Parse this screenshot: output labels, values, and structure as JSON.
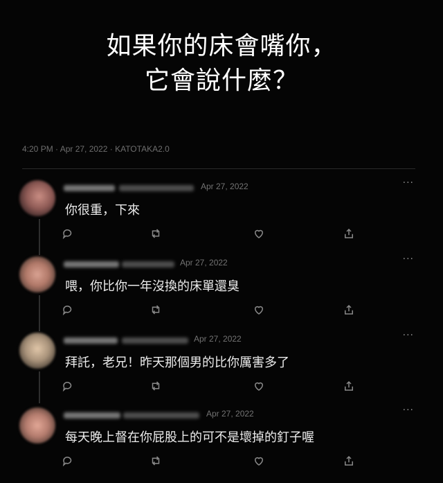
{
  "title": {
    "line1": "如果你的床會嘴你，",
    "line2": "它會說什麼？"
  },
  "tweet_meta": "4:20 PM · Apr 27, 2022 · KATOTAKA2.0",
  "replies": [
    {
      "date": "Apr 27, 2022",
      "text": "你很重，下來",
      "more_label": "···",
      "icons": [
        "reply-icon",
        "retweet-icon",
        "like-icon",
        "share-icon"
      ]
    },
    {
      "date": "Apr 27, 2022",
      "text": "喂，你比你一年沒換的床單還臭",
      "more_label": "···",
      "icons": [
        "reply-icon",
        "retweet-icon",
        "like-icon",
        "share-icon"
      ]
    },
    {
      "date": "Apr 27, 2022",
      "text": "拜託，老兄！昨天那個男的比你厲害多了",
      "more_label": "···",
      "icons": [
        "reply-icon",
        "retweet-icon",
        "like-icon",
        "share-icon"
      ]
    },
    {
      "date": "Apr 27, 2022",
      "text": "每天晚上督在你屁股上的可不是壞掉的釘子喔",
      "more_label": "···",
      "icons": [
        "reply-icon",
        "retweet-icon",
        "like-icon",
        "share-icon"
      ]
    }
  ],
  "colors": {
    "background": "#050505",
    "text": "#ececec",
    "muted": "#737373",
    "icon": "#8a8a8a"
  }
}
